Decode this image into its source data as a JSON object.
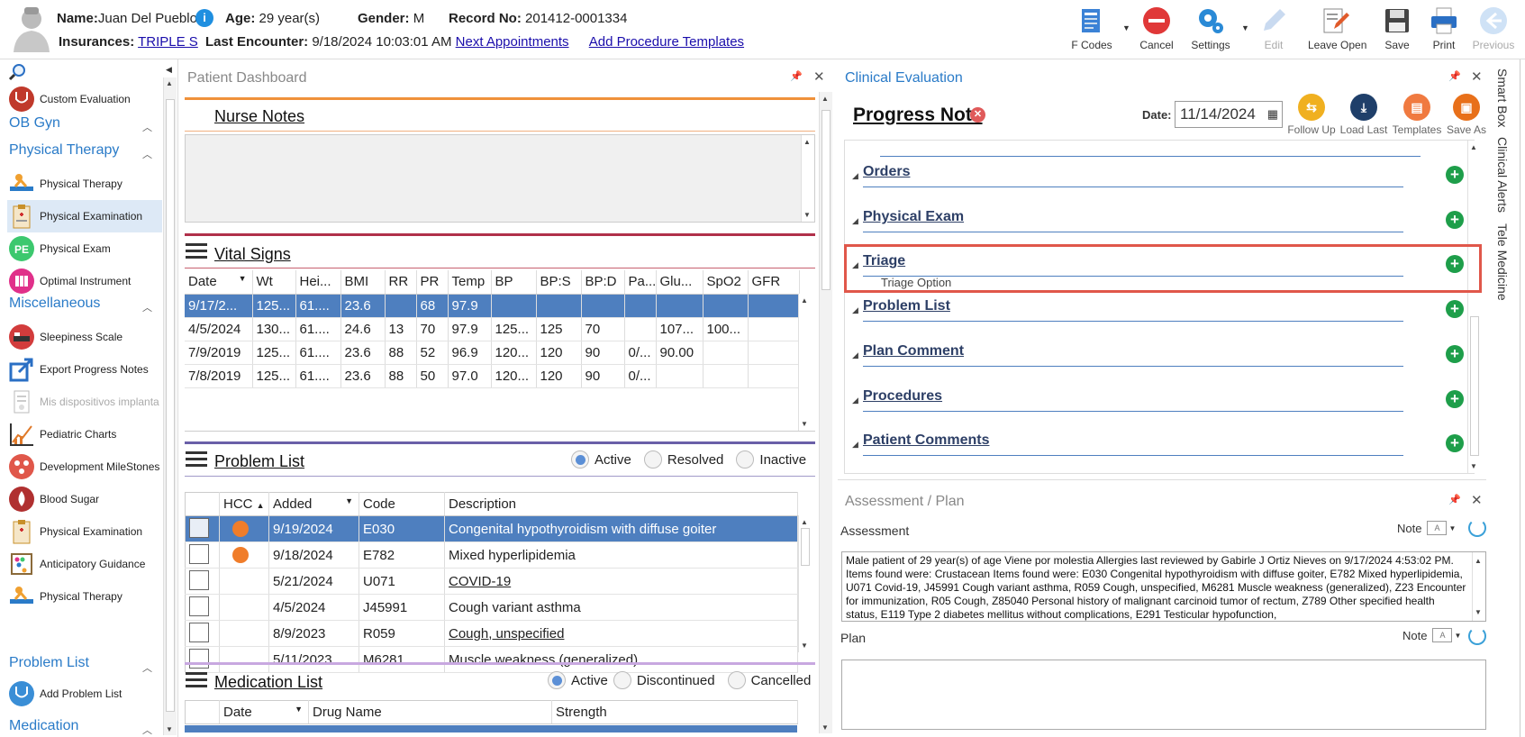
{
  "patient": {
    "name_label": "Name:",
    "name": "Juan Del Pueblo",
    "age_label": "Age:",
    "age": "29 year(s)",
    "gender_label": "Gender:",
    "gender": "M",
    "record_label": "Record No:",
    "record": "201412-0001334",
    "insurances_label": "Insurances:",
    "insurance": "TRIPLE S",
    "last_encounter_label": "Last Encounter:",
    "last_encounter": "9/18/2024 10:03:01 AM",
    "next_appointments": "Next Appointments",
    "add_procedure_templates": "Add Procedure Templates"
  },
  "toolbar": {
    "fcodes": "F Codes",
    "cancel": "Cancel",
    "settings": "Settings",
    "edit": "Edit",
    "leave_open": "Leave Open",
    "save": "Save",
    "print": "Print",
    "previous": "Previous"
  },
  "sidebar": {
    "items": [
      {
        "label": "Custom Evaluation"
      },
      {
        "header": "OB Gyn"
      },
      {
        "header": "Physical Therapy"
      },
      {
        "label": "Physical Therapy"
      },
      {
        "label": "Physical Examination"
      },
      {
        "label": "Physical Exam"
      },
      {
        "label": "Optimal Instrument"
      },
      {
        "header": "Miscellaneous"
      },
      {
        "label": "Sleepiness Scale"
      },
      {
        "label": "Export Progress Notes"
      },
      {
        "label": "Mis dispositivos implanta"
      },
      {
        "label": "Pediatric Charts"
      },
      {
        "label": "Development MileStones"
      },
      {
        "label": "Blood Sugar"
      },
      {
        "label": "Physical Examination"
      },
      {
        "label": "Anticipatory Guidance"
      },
      {
        "label": "Physical Therapy"
      },
      {
        "header": "Problem List"
      },
      {
        "label": "Add Problem List"
      },
      {
        "header": "Medication"
      }
    ]
  },
  "dashboard": {
    "title": "Patient Dashboard",
    "nurse_notes": "Nurse Notes",
    "vital_signs": "Vital Signs",
    "vitals_columns": [
      "Date",
      "Wt",
      "Hei...",
      "BMI",
      "RR",
      "PR",
      "Temp",
      "BP",
      "BP:S",
      "BP:D",
      "Pa...",
      "Glu...",
      "SpO2",
      "GFR"
    ],
    "vitals_rows": [
      [
        "9/17/2...",
        "125...",
        "61....",
        "23.6",
        "",
        "68",
        "97.9",
        "",
        "",
        "",
        "",
        "",
        "",
        ""
      ],
      [
        "4/5/2024",
        "130...",
        "61....",
        "24.6",
        "13",
        "70",
        "97.9",
        "125...",
        "125",
        "70",
        "",
        "107...",
        "100...",
        ""
      ],
      [
        "7/9/2019",
        "125...",
        "61....",
        "23.6",
        "88",
        "52",
        "96.9",
        "120...",
        "120",
        "90",
        "0/...",
        "90.00",
        "",
        ""
      ],
      [
        "7/8/2019",
        "125...",
        "61....",
        "23.6",
        "88",
        "50",
        "97.0",
        "120...",
        "120",
        "90",
        "0/...",
        "",
        "",
        ""
      ]
    ],
    "problem_list": "Problem List",
    "problem_filters": [
      "Active",
      "Resolved",
      "Inactive"
    ],
    "problem_columns": [
      "",
      "HCC",
      "Added",
      "Code",
      "Description"
    ],
    "problem_rows": [
      {
        "hcc": true,
        "added": "9/19/2024",
        "code": "E030",
        "desc": "Congenital hypothyroidism with diffuse goiter"
      },
      {
        "hcc": true,
        "added": "9/18/2024",
        "code": "E782",
        "desc": "Mixed hyperlipidemia"
      },
      {
        "hcc": false,
        "added": "5/21/2024",
        "code": "U071",
        "desc": "COVID-19"
      },
      {
        "hcc": false,
        "added": "4/5/2024",
        "code": "J45991",
        "desc": "Cough variant asthma"
      },
      {
        "hcc": false,
        "added": "8/9/2023",
        "code": "R059",
        "desc": "Cough, unspecified"
      },
      {
        "hcc": false,
        "added": "5/11/2023",
        "code": "M6281",
        "desc": "Muscle weakness (generalized)"
      }
    ],
    "medication_list": "Medication List",
    "med_filters": [
      "Active",
      "Discontinued",
      "Cancelled"
    ],
    "med_columns": [
      "",
      "Date",
      "Drug Name",
      "Strength"
    ]
  },
  "clinical": {
    "title": "Clinical Evaluation",
    "note_title": "Progress Note",
    "date_label": "Date:",
    "date": "11/14/2024",
    "actions": [
      "Follow Up",
      "Load Last",
      "Templates",
      "Save As"
    ],
    "sections": [
      "Orders",
      "Physical Exam",
      "Triage",
      "Problem List",
      "Plan Comment",
      "Procedures",
      "Patient Comments"
    ],
    "triage_option": "Triage Option"
  },
  "side_tabs": [
    "Smart Box",
    "Clinical Alerts",
    "Tele Medicine"
  ],
  "assessment": {
    "title": "Assessment / Plan",
    "assessment_label": "Assessment",
    "note_label": "Note",
    "text": "Male patient of 29 year(s) of age Viene por molestia     Allergies last reviewed by Gabirle J Ortiz Nieves on 9/17/2024 4:53:02 PM.    Items found were:  Crustacean  Items found were:  E030 Congenital hypothyroidism with diffuse goiter, E782 Mixed hyperlipidemia, U071 Covid-19, J45991 Cough variant asthma, R059 Cough, unspecified, M6281 Muscle weakness (generalized), Z23 Encounter for immunization, R05 Cough, Z85040 Personal history of malignant carcinoid tumor of rectum, Z789 Other specified health status, E119 Type 2 diabetes mellitus without complications, E291 Testicular hypofunction,",
    "plan_label": "Plan"
  },
  "colors": {
    "accent": "#2a7bc8",
    "selected_row": "#4e7fbf",
    "highlight_border": "#e0574a",
    "plus_green": "#1e9e4a"
  }
}
